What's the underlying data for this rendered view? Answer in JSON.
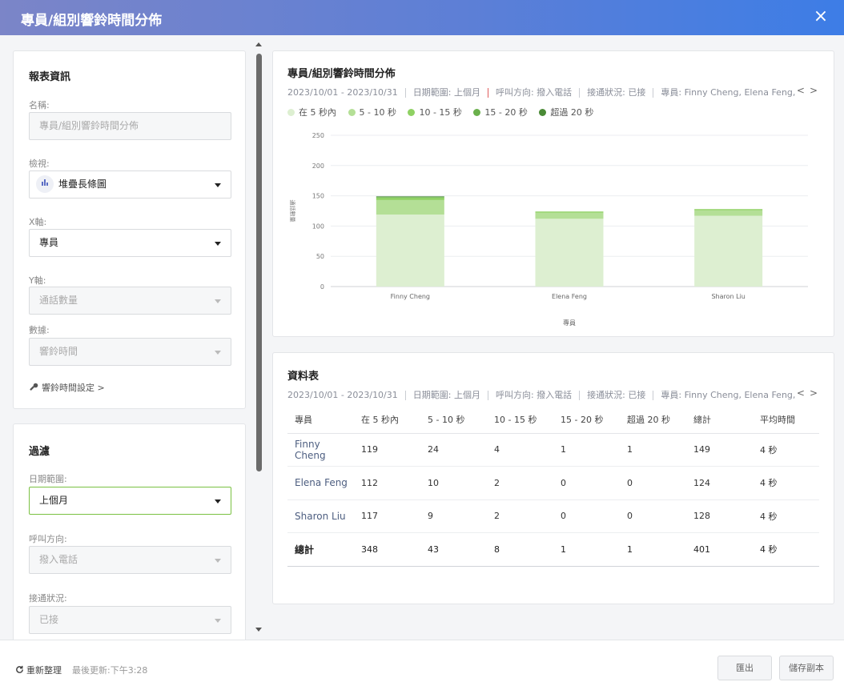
{
  "dialog": {
    "title": "專員/組別響鈴時間分佈",
    "close_icon": "×"
  },
  "report_info": {
    "heading": "報表資訊",
    "name_label": "名稱:",
    "name_placeholder": "專員/組別響鈴時間分佈",
    "view_label": "檢視:",
    "view_value": "堆疊長條圖",
    "view_icon": "bar-chart-icon",
    "x_label": "X軸:",
    "x_value": "專員",
    "y_label": "Y軸:",
    "y_value": "通話數量",
    "data_label": "數據:",
    "data_value": "響鈴時間",
    "settings_link": "響鈴時間設定 >",
    "settings_icon": "wrench-icon"
  },
  "filters": {
    "heading": "過濾",
    "date_label": "日期範圍:",
    "date_value": "上個月",
    "direction_label": "呼叫方向:",
    "direction_value": "撥入電話",
    "status_label": "接通狀況:",
    "status_value": "已接"
  },
  "summary": [
    "2023/10/01 - 2023/10/31",
    "日期範圍: 上個月",
    "呼叫方向: 撥入電話",
    "接通狀況: 已接",
    "專員: Finny Cheng, Elena Feng, Sharon Liu"
  ],
  "nav": {
    "prev": "<",
    "next": ">"
  },
  "chart_panel": {
    "title": "專員/組別響鈴時間分佈"
  },
  "chart_data": {
    "type": "bar",
    "stacked": true,
    "categories": [
      "Finny Cheng",
      "Elena Feng",
      "Sharon Liu"
    ],
    "series": [
      {
        "name": "在 5 秒內",
        "color": "#ddefd1",
        "values": [
          119,
          112,
          117
        ]
      },
      {
        "name": "5 - 10 秒",
        "color": "#b4df96",
        "values": [
          24,
          10,
          9
        ]
      },
      {
        "name": "10 - 15 秒",
        "color": "#8fd163",
        "values": [
          4,
          2,
          2
        ]
      },
      {
        "name": "15 - 20 秒",
        "color": "#6ab04c",
        "values": [
          1,
          0,
          0
        ]
      },
      {
        "name": "超過 20 秒",
        "color": "#4a8a36",
        "values": [
          1,
          0,
          0
        ]
      }
    ],
    "yticks": [
      "0",
      "50",
      "100",
      "150",
      "200",
      "250"
    ],
    "ylim": [
      0,
      250
    ],
    "xlabel": "專員",
    "ylabel": "通話數量",
    "legend": "top-left",
    "grid": true
  },
  "table_panel": {
    "title": "資料表",
    "headers": [
      "專員",
      "在 5 秒內",
      "5 - 10 秒",
      "10 - 15 秒",
      "15 - 20 秒",
      "超過 20 秒",
      "總計",
      "平均時間"
    ],
    "rows": [
      [
        "Finny Cheng",
        "119",
        "24",
        "4",
        "1",
        "1",
        "149",
        "4 秒"
      ],
      [
        "Elena Feng",
        "112",
        "10",
        "2",
        "0",
        "0",
        "124",
        "4 秒"
      ],
      [
        "Sharon Liu",
        "117",
        "9",
        "2",
        "0",
        "0",
        "128",
        "4 秒"
      ],
      [
        "總計",
        "348",
        "43",
        "8",
        "1",
        "1",
        "401",
        "4 秒"
      ]
    ]
  },
  "footer": {
    "refresh_label": "重新整理",
    "refresh_icon": "refresh-icon",
    "last_update": "最後更新:下午3:28",
    "export_label": "匯出",
    "save_copy_label": "儲存副本"
  }
}
